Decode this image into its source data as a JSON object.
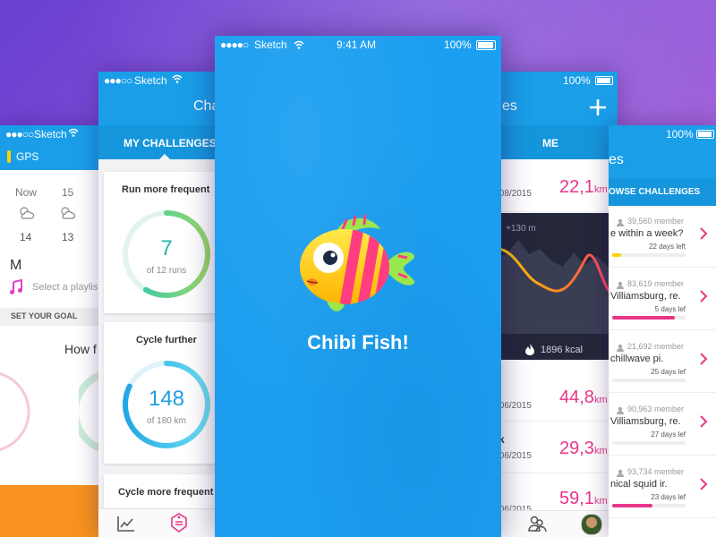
{
  "status": {
    "carrier": "Sketch",
    "time": "9:41 AM",
    "battery": "100%"
  },
  "phone1": {
    "gps": "GPS",
    "weather": [
      {
        "label": "Now",
        "temp": "14"
      },
      {
        "label": "15",
        "temp": "13"
      }
    ],
    "mode": "M",
    "playlist": "Select a playlist",
    "goal": "SET YOUR GOAL",
    "question": "How f"
  },
  "phone2": {
    "title": "Cha",
    "tab": "MY CHALLENGES",
    "cards": [
      {
        "title": "Run more frequent",
        "value": "7",
        "unit": "of 12 runs",
        "progress": 0.583
      },
      {
        "title": "Cycle further",
        "value": "148",
        "unit": "of 180 km",
        "progress": 0.822
      },
      {
        "title": "Cycle more frequent"
      }
    ]
  },
  "splash": {
    "title": "Chibi Fish!",
    "colors": {
      "fish_body": "#ffd600",
      "stripe_pink": "#ff3d7f",
      "fin_green": "#8fe04a"
    }
  },
  "phone4": {
    "title": "es",
    "tab": "ME",
    "rows": [
      {
        "date": "/08/2015",
        "value": "22,1",
        "unit": "km"
      },
      {
        "date": "/06/2015",
        "value": "44,8",
        "unit": "km"
      },
      {
        "date": "/06/2015",
        "value": "29,3",
        "unit": "km",
        "prefix": "k"
      },
      {
        "date": "/06/2015",
        "value": "59,1",
        "unit": "km"
      }
    ],
    "chart": {
      "elevation": "+130 m",
      "kcal": "1896 kcal"
    }
  },
  "phone5": {
    "title": "es",
    "tab": "OWSE CHALLENGES",
    "items": [
      {
        "members": "39,560 member",
        "name": "e within a week?",
        "days": "22 days left",
        "progress": 0.12,
        "bar_color": "#ffd200"
      },
      {
        "members": "83,619 member",
        "name": "Villiamsburg, re.",
        "days": "5 days lef",
        "progress": 0.85,
        "bar_color": "#e8358a"
      },
      {
        "members": "21,692 member",
        "name": "chillwave pi.",
        "days": "25 days lef",
        "progress": 0.0,
        "bar_color": "#e8358a"
      },
      {
        "members": "90,963 member",
        "name": "Villiamsburg, re.",
        "days": "27 days lef",
        "progress": 0.0,
        "bar_color": "#e8358a"
      },
      {
        "members": "93,734 member",
        "name": "nical squid ir.",
        "days": "23 days lef",
        "progress": 0.55,
        "bar_color": "#e8358a"
      }
    ]
  },
  "colors": {
    "primary": "#1a9ee8",
    "accent_pink": "#e8358a",
    "bg_top": "#6a3fd1",
    "bg_bottom": "#b867d8"
  }
}
